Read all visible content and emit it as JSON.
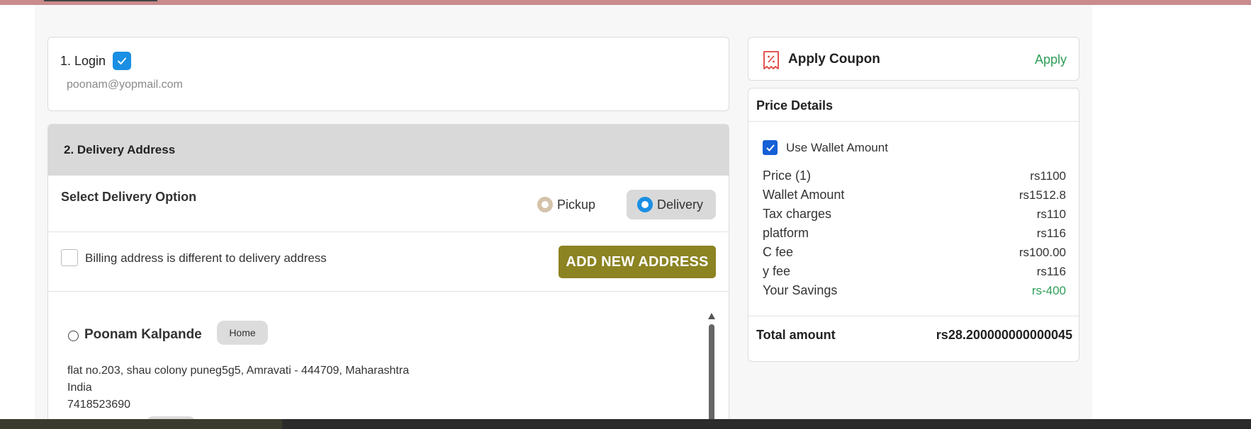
{
  "login": {
    "title": "1. Login",
    "email": "poonam@yopmail.com"
  },
  "delivery": {
    "header": "2. Delivery Address",
    "option_label": "Select Delivery Option",
    "options": [
      {
        "label": "Pickup",
        "selected": false
      },
      {
        "label": "Delivery",
        "selected": true
      }
    ],
    "billing_label": "Billing address is different to delivery address",
    "add_button": "ADD NEW ADDRESS",
    "addresses": [
      {
        "name": "Poonam Kalpande",
        "tag": "Home",
        "line1": "flat no.203, shau colony puneg5g5, Amravati - 444709, Maharashtra",
        "line2": "India",
        "phone": "7418523690"
      }
    ]
  },
  "coupon": {
    "title": "Apply Coupon",
    "action": "Apply"
  },
  "price": {
    "title": "Price Details",
    "wallet_label": "Use Wallet Amount",
    "rows": [
      {
        "label": "Price (1)",
        "value": "rs1100"
      },
      {
        "label": "Wallet Amount",
        "value": "rs1512.8"
      },
      {
        "label": "Tax charges",
        "value": "rs110"
      },
      {
        "label": "platform",
        "value": "rs116"
      },
      {
        "label": "C fee",
        "value": "rs100.00"
      },
      {
        "label": "y fee",
        "value": "rs116"
      },
      {
        "label": "Your Savings",
        "value": "rs-400"
      }
    ],
    "total_label": "Total amount",
    "total_value": "rs28.200000000000045"
  },
  "colors": {
    "accent_blue": "#1a8fe3",
    "add_button": "#8c8322",
    "success_green": "#2e9e57"
  }
}
